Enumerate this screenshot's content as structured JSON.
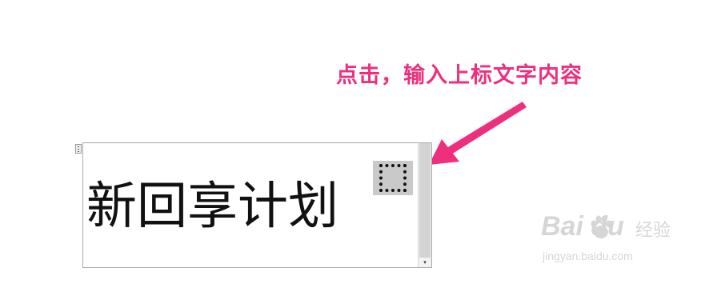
{
  "annotation": {
    "text": "点击，输入上标文字内容",
    "color": "#ee2f7e"
  },
  "editor": {
    "text": "新回享计划",
    "superscript_placeholder": "superscript-placeholder"
  },
  "scrollbar": {
    "down_glyph": "▾"
  },
  "watermark": {
    "brand": "Bai  du",
    "brand_cn": "经验",
    "url": "jingyan.baidu.com"
  }
}
